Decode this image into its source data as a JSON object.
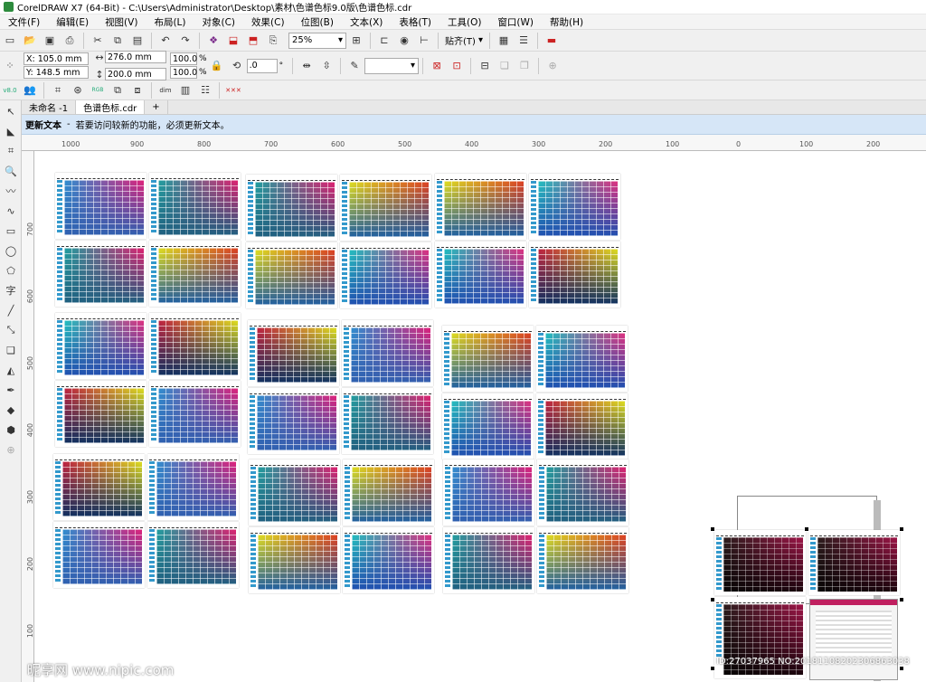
{
  "window": {
    "title": "CorelDRAW X7 (64-Bit) - C:\\Users\\Administrator\\Desktop\\素材\\色谱色标9.0版\\色谱色标.cdr"
  },
  "menu": [
    "文件(F)",
    "编辑(E)",
    "视图(V)",
    "布局(L)",
    "对象(C)",
    "效果(C)",
    "位图(B)",
    "文本(X)",
    "表格(T)",
    "工具(O)",
    "窗口(W)",
    "帮助(H)"
  ],
  "toolbar": {
    "zoom": "25%",
    "snap": "贴齐(T)"
  },
  "props": {
    "x": "X: 105.0 mm",
    "y": "Y: 148.5 mm",
    "w": "276.0 mm",
    "h": "200.0 mm",
    "sx": "100.0",
    "sy": "100.0",
    "pct": "%",
    "angle": ".0",
    "deg": "°"
  },
  "toolbar3": {
    "zoomv": "8.0"
  },
  "tabs": [
    "未命名 -1",
    "色谱色标.cdr"
  ],
  "notice": {
    "title": "更新文本",
    "dash": "-",
    "text": "若要访问较新的功能，必须更新文本。"
  },
  "ruler": {
    "h": [
      "1000",
      "900",
      "800",
      "700",
      "600",
      "500",
      "400",
      "300",
      "200",
      "100",
      "0",
      "100",
      "200"
    ],
    "v": [
      "700",
      "600",
      "500",
      "400",
      "300",
      "200",
      "100"
    ]
  },
  "watermarks": {
    "left": "昵享网 www.nipic.com",
    "right": "ID:27037965 NO:20181108202306863038"
  },
  "colors": {
    "accent": "#d6e6f7",
    "canvas": "#ffffff"
  }
}
